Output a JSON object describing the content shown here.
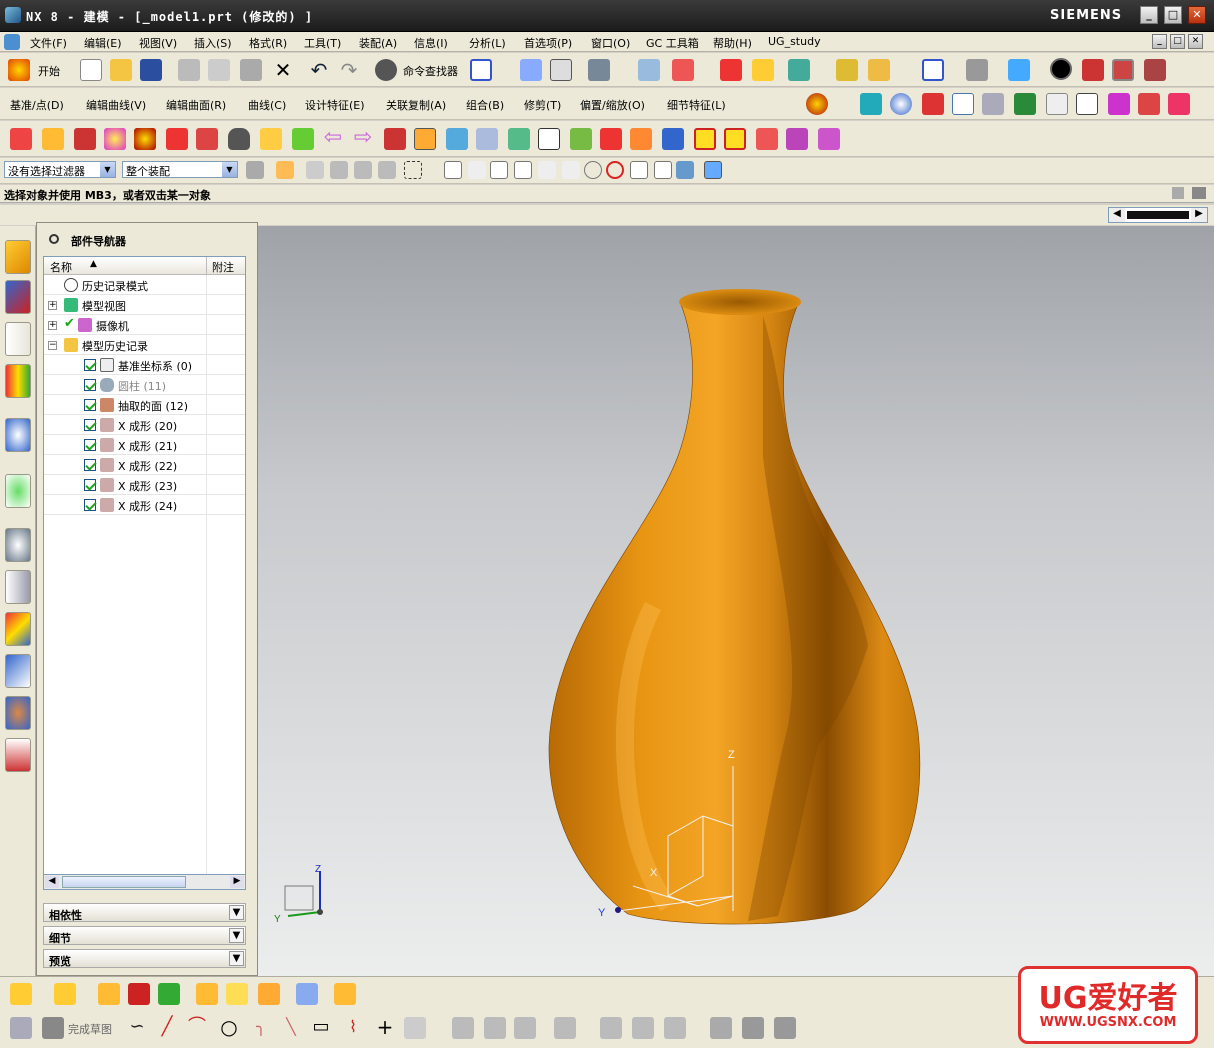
{
  "window": {
    "title": "NX 8 - 建模 - [_model1.prt (修改的) ]",
    "brand": "SIEMENS",
    "controls": [
      "_",
      "□",
      "✕"
    ]
  },
  "menubar": {
    "items": [
      "文件(F)",
      "编辑(E)",
      "视图(V)",
      "插入(S)",
      "格式(R)",
      "工具(T)",
      "装配(A)",
      "信息(I)",
      "分析(L)",
      "首选项(P)",
      "窗口(O)",
      "GC 工具箱",
      "帮助(H)",
      "UG_study"
    ]
  },
  "standard_toolbar": {
    "start_label": "开始",
    "command_finder_label": "命令查找器"
  },
  "feature_toolbar": {
    "items": [
      "基准/点(D)",
      "编辑曲线(V)",
      "编辑曲面(R)",
      "曲线(C)",
      "设计特征(E)",
      "关联复制(A)",
      "组合(B)",
      "修剪(T)",
      "偏置/缩放(O)",
      "细节特征(L)"
    ]
  },
  "selection_bar": {
    "filter_value": "没有选择过滤器",
    "scope_value": "整个装配"
  },
  "status": {
    "prompt": "选择对象并使用 MB3，或者双击某一对象"
  },
  "part_navigator": {
    "title": "部件导航器",
    "col_name": "名称",
    "col_note": "附注",
    "rows": [
      {
        "label": "历史记录模式",
        "indent": 1
      },
      {
        "label": "模型视图",
        "indent": 1
      },
      {
        "label": "摄像机",
        "indent": 1
      },
      {
        "label": "模型历史记录",
        "indent": 1
      },
      {
        "label": "基准坐标系 (0)",
        "indent": 2
      },
      {
        "label": "圆柱 (11)",
        "indent": 2
      },
      {
        "label": "抽取的面 (12)",
        "indent": 2
      },
      {
        "label": "X 成形 (20)",
        "indent": 2
      },
      {
        "label": "X 成形 (21)",
        "indent": 2
      },
      {
        "label": "X 成形 (22)",
        "indent": 2
      },
      {
        "label": "X 成形 (23)",
        "indent": 2
      },
      {
        "label": "X 成形 (24)",
        "indent": 2
      }
    ],
    "sections": [
      "相依性",
      "细节",
      "预览"
    ]
  },
  "viewport": {
    "axis_labels": {
      "z": "Z",
      "x": "X",
      "y": "Y"
    },
    "model_color": "#e08a10"
  },
  "bottom_toolbar": {
    "finish_sketch_label": "完成草图"
  },
  "watermark": {
    "title": "UG爱好者",
    "url": "WWW.UGSNX.COM"
  }
}
